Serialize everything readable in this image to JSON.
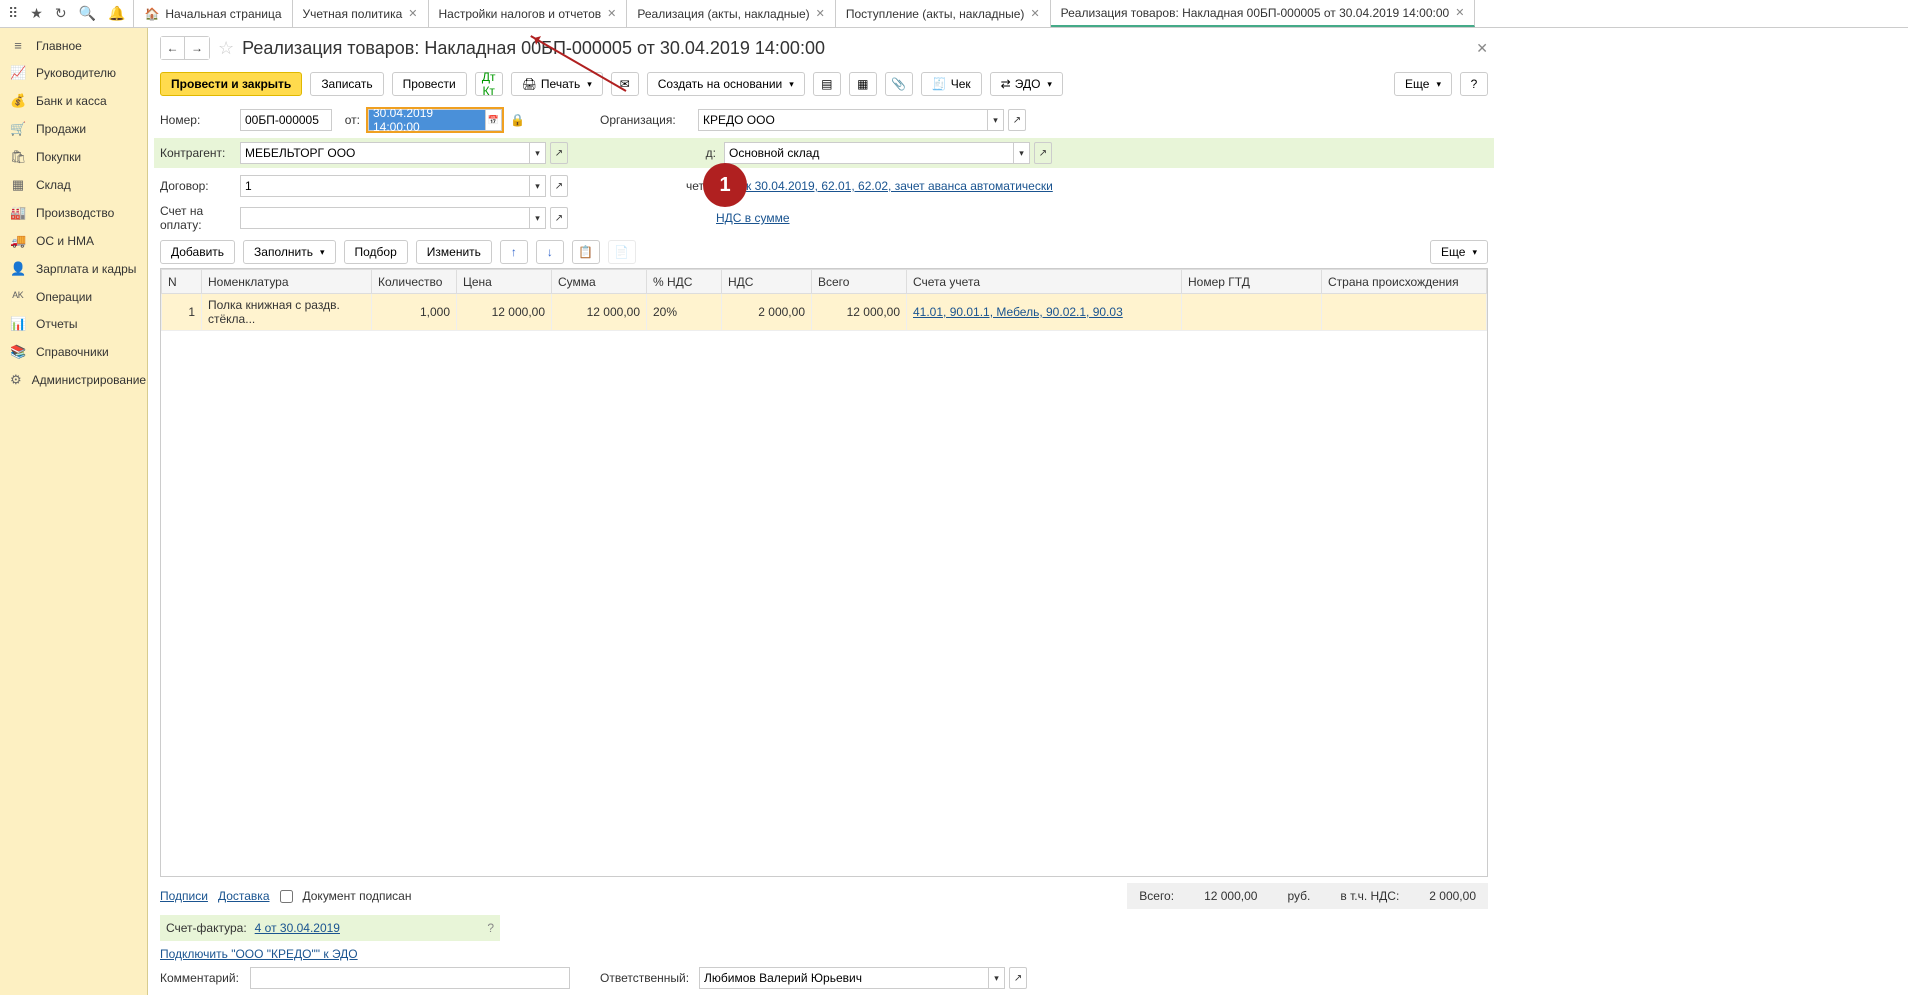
{
  "tabs": {
    "home": "Начальная страница",
    "t1": "Учетная политика",
    "t2": "Настройки налогов и отчетов",
    "t3": "Реализация (акты, накладные)",
    "t4": "Поступление (акты, накладные)",
    "t5": "Реализация товаров: Накладная 00БП-000005 от 30.04.2019 14:00:00"
  },
  "sidebar": [
    {
      "icon": "≡",
      "label": "Главное"
    },
    {
      "icon": "📈",
      "label": "Руководителю"
    },
    {
      "icon": "💰",
      "label": "Банк и касса"
    },
    {
      "icon": "🛒",
      "label": "Продажи"
    },
    {
      "icon": "🛍",
      "label": "Покупки"
    },
    {
      "icon": "▦",
      "label": "Склад"
    },
    {
      "icon": "🏭",
      "label": "Производство"
    },
    {
      "icon": "🚚",
      "label": "ОС и НМА"
    },
    {
      "icon": "👤",
      "label": "Зарплата и кадры"
    },
    {
      "icon": "ᴬᴷ",
      "label": "Операции"
    },
    {
      "icon": "📊",
      "label": "Отчеты"
    },
    {
      "icon": "📚",
      "label": "Справочники"
    },
    {
      "icon": "⚙",
      "label": "Администрирование"
    }
  ],
  "title": "Реализация товаров: Накладная 00БП-000005 от 30.04.2019 14:00:00",
  "cmd": {
    "post_close": "Провести и закрыть",
    "write": "Записать",
    "post": "Провести",
    "print": "Печать",
    "create_based": "Создать на основании",
    "check": "Чек",
    "edo": "ЭДО",
    "more": "Еще"
  },
  "form": {
    "number_lbl": "Номер:",
    "number": "00БП-000005",
    "from_lbl": "от:",
    "date": "30.04.2019 14:00:00",
    "org_lbl": "Организация:",
    "org": "КРЕДО ООО",
    "ctr_lbl": "Контрагент:",
    "ctr": "МЕБЕЛЬТОРГ ООО",
    "wh_lbl": "Склад:",
    "wh": "Основной склад",
    "contract_lbl": "Договор:",
    "contract": "1",
    "calc_lbl": "Расчеты:",
    "calc_link": "Срок 30.04.2019, 62.01, 62.02, зачет аванса автоматически",
    "invoice_lbl": "Счет на оплату:",
    "vat_link": "НДС в сумме"
  },
  "tbl_cmd": {
    "add": "Добавить",
    "fill": "Заполнить",
    "select": "Подбор",
    "change": "Изменить"
  },
  "columns": {
    "n": "N",
    "nom": "Номенклатура",
    "qty": "Количество",
    "price": "Цена",
    "sum": "Сумма",
    "vat_rate": "% НДС",
    "vat": "НДС",
    "total": "Всего",
    "acc": "Счета учета",
    "gtd": "Номер ГТД",
    "country": "Страна происхождения"
  },
  "rows": [
    {
      "n": "1",
      "nom": "Полка книжная с раздв. стёкла...",
      "qty": "1,000",
      "price": "12 000,00",
      "sum": "12 000,00",
      "vat_rate": "20%",
      "vat": "2 000,00",
      "total": "12 000,00",
      "acc": "41.01, 90.01.1, Мебель, 90.02.1, 90.03"
    }
  ],
  "footer": {
    "sign": "Подписи",
    "delivery": "Доставка",
    "signed": "Документ подписан",
    "total_lbl": "Всего:",
    "total": "12 000,00",
    "cur": "руб.",
    "incl_vat_lbl": "в т.ч. НДС:",
    "incl_vat": "2 000,00",
    "sf_lbl": "Счет-фактура:",
    "sf_link": "4 от 30.04.2019",
    "edo_link": "Подключить \"ООО \"КРЕДО\"\" к ЭДО",
    "comment_lbl": "Комментарий:",
    "resp_lbl": "Ответственный:",
    "resp": "Любимов Валерий Юрьевич"
  },
  "callout": "1"
}
